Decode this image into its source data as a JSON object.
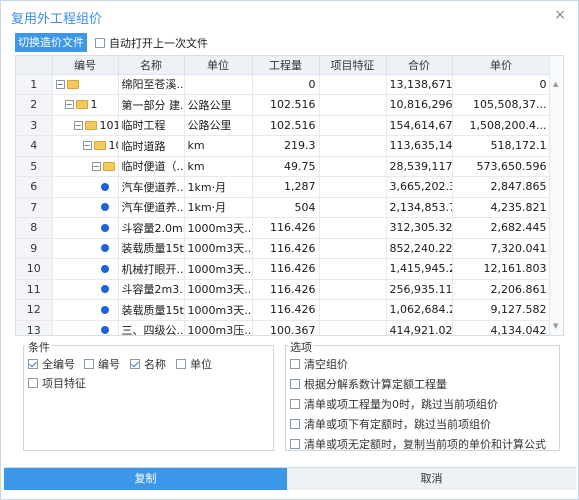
{
  "window": {
    "title": "复用外工程组价",
    "close_glyph": "×"
  },
  "toolbar": {
    "switch_label": "切换造价文件",
    "auto_open_label": "自动打开上一次文件"
  },
  "grid": {
    "columns": [
      "",
      "编号",
      "名称",
      "单位",
      "工程量",
      "项目特征",
      "合价",
      "单价"
    ],
    "rows": [
      {
        "n": "1",
        "indent": 0,
        "exp": "−",
        "icon": "folder",
        "code": "",
        "name": "绵阳至苍溪...",
        "unit": "",
        "qty": "0",
        "feat": "",
        "total": "13,138,671,...",
        "price": "0"
      },
      {
        "n": "2",
        "indent": 1,
        "exp": "−",
        "icon": "folder",
        "code": "1",
        "name": "第一部分 建...",
        "unit": "公路公里",
        "qty": "102.516",
        "feat": "",
        "total": "10,816,296,...",
        "price": "105,508,37..."
      },
      {
        "n": "3",
        "indent": 2,
        "exp": "−",
        "icon": "folder",
        "code": "101",
        "name": "临时工程",
        "unit": "公路公里",
        "qty": "102.516",
        "feat": "",
        "total": "154,614,67...",
        "price": "1,508,200.4..."
      },
      {
        "n": "4",
        "indent": 3,
        "exp": "−",
        "icon": "folder",
        "code": "10",
        "name": "临时道路",
        "unit": "km",
        "qty": "219.3",
        "feat": "",
        "total": "113,635,14...",
        "price": "518,172.1"
      },
      {
        "n": "5",
        "indent": 4,
        "exp": "−",
        "icon": "folder",
        "code": "1",
        "name": "临时便道（...",
        "unit": "km",
        "qty": "49.75",
        "feat": "",
        "total": "28,539,117....",
        "price": "573,650.596"
      },
      {
        "n": "6",
        "indent": 5,
        "exp": "",
        "icon": "dot",
        "code": "",
        "name": "汽车便道养...",
        "unit": "1km·月",
        "qty": "1,287",
        "feat": "",
        "total": "3,665,202.39",
        "price": "2,847.865"
      },
      {
        "n": "7",
        "indent": 5,
        "exp": "",
        "icon": "dot",
        "code": "",
        "name": "汽车便道养...",
        "unit": "1km·月",
        "qty": "504",
        "feat": "",
        "total": "2,134,853.7...",
        "price": "4,235.821"
      },
      {
        "n": "8",
        "indent": 5,
        "exp": "",
        "icon": "dot",
        "code": "",
        "name": "斗容量2.0m...",
        "unit": "1000m3天...",
        "qty": "116.426",
        "feat": "",
        "total": "312,305.325",
        "price": "2,682.445"
      },
      {
        "n": "9",
        "indent": 5,
        "exp": "",
        "icon": "dot",
        "code": "",
        "name": "装载质量15t...",
        "unit": "1000m3天...",
        "qty": "116.426",
        "feat": "",
        "total": "852,240.221",
        "price": "7,320.041"
      },
      {
        "n": "10",
        "indent": 5,
        "exp": "",
        "icon": "dot",
        "code": "",
        "name": "机械打眼开...",
        "unit": "1000m3天...",
        "qty": "116.426",
        "feat": "",
        "total": "1,415,945.2...",
        "price": "12,161.803"
      },
      {
        "n": "11",
        "indent": 5,
        "exp": "",
        "icon": "dot",
        "code": "",
        "name": "斗容量2m3...",
        "unit": "1000m3天...",
        "qty": "116.426",
        "feat": "",
        "total": "256,935.117",
        "price": "2,206.861"
      },
      {
        "n": "12",
        "indent": 5,
        "exp": "",
        "icon": "dot",
        "code": "",
        "name": "装载质量15t...",
        "unit": "1000m3天...",
        "qty": "116.426",
        "feat": "",
        "total": "1,062,684.26",
        "price": "9,127.582"
      },
      {
        "n": "13",
        "indent": 5,
        "exp": "",
        "icon": "dot",
        "code": "",
        "name": "三、四级公...",
        "unit": "1000m3压...",
        "qty": "100.367",
        "feat": "",
        "total": "414,921.026",
        "price": "4,134.042"
      }
    ]
  },
  "conditions": {
    "legend": "条件",
    "items": [
      {
        "label": "全编号",
        "checked": true
      },
      {
        "label": "编号",
        "checked": false
      },
      {
        "label": "名称",
        "checked": true
      },
      {
        "label": "单位",
        "checked": false
      },
      {
        "label": "项目特征",
        "checked": false
      }
    ]
  },
  "options": {
    "legend": "选项",
    "items": [
      {
        "label": "清空组价",
        "checked": false
      },
      {
        "label": "根据分解系数计算定额工程量",
        "checked": false
      },
      {
        "label": "清单或项工程量为0时，跳过当前项组价",
        "checked": false
      },
      {
        "label": "清单或项下有定额时，跳过当前项组价",
        "checked": false
      },
      {
        "label": "清单或项无定额时，复制当前项的单价和计算公式",
        "checked": false
      }
    ]
  },
  "footer": {
    "copy_label": "复制",
    "cancel_label": "取消"
  },
  "colors": {
    "accent": "#3d97e8",
    "title": "#3a8ee6",
    "item_dot": "#1f63d6",
    "folder": "#f5c85b"
  }
}
